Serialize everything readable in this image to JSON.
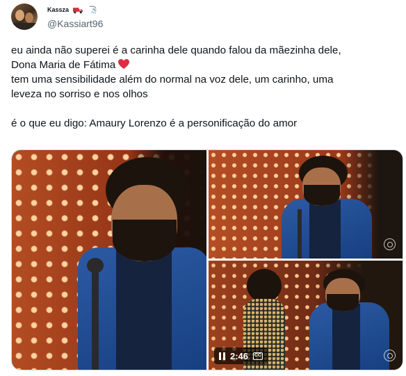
{
  "author": {
    "display_name": "Kassza",
    "handle": "@Kassiart96",
    "avatar_icon": "profile-photo-icon",
    "name_emojis": [
      "truck-emoji",
      "shower-emoji"
    ]
  },
  "tweet": {
    "line1": "eu ainda não superei é a carinha dele quando falou da mãezinha dele,",
    "line2": "Dona Maria de Fátima",
    "line2_emoji": "red-heart-emoji",
    "line3": "tem uma sensibilidade além do normal na voz dele, um carinho, uma",
    "line4": "leveza no sorriso e nos olhos",
    "line5": "é o que eu digo: Amaury Lorenzo é a personificação do amor"
  },
  "media": {
    "video": {
      "time": "2:46",
      "cc_label": "CC",
      "pause_icon": "pause-icon",
      "cc_icon": "closed-captions-icon"
    },
    "watermark_icon": "globoplay-logo-icon"
  },
  "colors": {
    "text": "#0f1419",
    "secondary": "#536471",
    "heart": "#f91880",
    "border": "#cfd9de"
  }
}
